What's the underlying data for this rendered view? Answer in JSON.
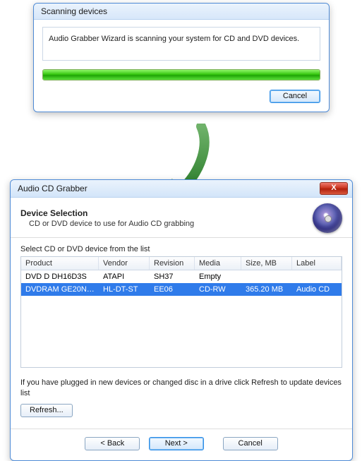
{
  "scan": {
    "title": "Scanning devices",
    "message": "Audio Grabber Wizard is scanning your system for CD and DVD devices.",
    "cancel": "Cancel"
  },
  "wizard": {
    "window_title": "Audio CD Grabber",
    "heading": "Device Selection",
    "subheading": "CD or DVD device to use for Audio CD grabbing",
    "list_label": "Select CD or DVD device from the list",
    "columns": {
      "product": "Product",
      "vendor": "Vendor",
      "revision": "Revision",
      "media": "Media",
      "size": "Size, MB",
      "label": "Label"
    },
    "rows": [
      {
        "product": "DVD D  DH16D3S",
        "vendor": "ATAPI",
        "revision": "SH37",
        "media": "Empty",
        "size": "",
        "label": ""
      },
      {
        "product": "DVDRAM GE20N…",
        "vendor": "HL-DT-ST",
        "revision": "EE06",
        "media": "CD-RW",
        "size": "365.20 MB",
        "label": "Audio CD"
      }
    ],
    "hint": "If you have plugged in new devices or changed disc in a drive click Refresh to update devices list",
    "refresh": "Refresh...",
    "back": "< Back",
    "next": "Next >",
    "cancel": "Cancel",
    "close_glyph": "X"
  }
}
